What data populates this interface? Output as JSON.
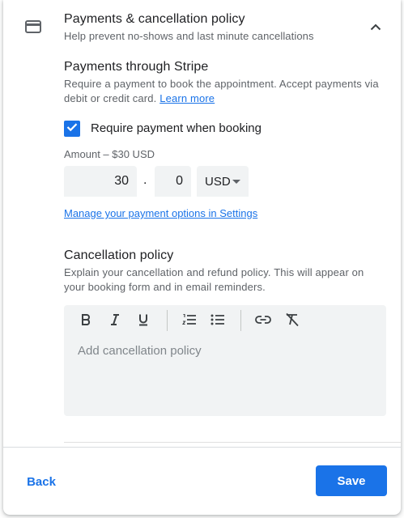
{
  "section": {
    "icon": "credit-card-icon",
    "title": "Payments & cancellation policy",
    "subtitle": "Help prevent no-shows and last minute cancellations",
    "collapse_icon": "chevron-up-icon"
  },
  "payments": {
    "title": "Payments through Stripe",
    "description": "Require a payment to book the appointment. Accept payments via debit or credit card.",
    "learn_more": "Learn more",
    "require_payment_label": "Require payment when booking",
    "require_payment_checked": true,
    "amount_label": "Amount – $30 USD",
    "amount_whole": "30",
    "separator": ".",
    "amount_cents": "0",
    "currency": "USD",
    "manage_link": "Manage your payment options in Settings"
  },
  "cancellation": {
    "title": "Cancellation policy",
    "description": "Explain your cancellation and refund policy. This will appear on your booking form and in email reminders.",
    "placeholder": "Add cancellation policy",
    "toolbar": [
      "bold-icon",
      "italic-icon",
      "underline-icon",
      "numbered-list-icon",
      "bulleted-list-icon",
      "link-icon",
      "clear-formatting-icon"
    ]
  },
  "footer": {
    "back_label": "Back",
    "save_label": "Save"
  },
  "colors": {
    "accent": "#1a73e8",
    "field_bg": "#f1f3f4"
  }
}
